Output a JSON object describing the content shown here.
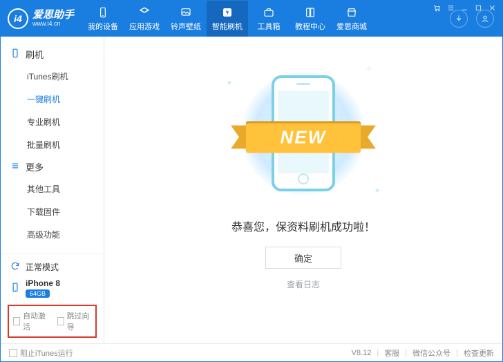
{
  "app": {
    "logo_text": "i4",
    "title": "爱思助手",
    "url": "www.i4.cn"
  },
  "nav": {
    "items": [
      {
        "name": "my-device",
        "label": "我的设备"
      },
      {
        "name": "apps-games",
        "label": "应用游戏"
      },
      {
        "name": "ring-wallpaper",
        "label": "铃声壁纸"
      },
      {
        "name": "smart-flash",
        "label": "智能刷机",
        "active": true
      },
      {
        "name": "toolbox",
        "label": "工具箱"
      },
      {
        "name": "tutorial",
        "label": "教程中心"
      },
      {
        "name": "mall",
        "label": "爱思商城"
      }
    ]
  },
  "sidebar": {
    "group_flash": "刷机",
    "flash_items": [
      {
        "label": "iTunes刷机"
      },
      {
        "label": "一键刷机",
        "active": true
      },
      {
        "label": "专业刷机"
      },
      {
        "label": "批量刷机"
      }
    ],
    "group_more": "更多",
    "more_items": [
      {
        "label": "其他工具"
      },
      {
        "label": "下载固件"
      },
      {
        "label": "高级功能"
      }
    ],
    "mode": "正常模式",
    "device_name": "iPhone 8",
    "storage_badge": "64GB",
    "auto_activate": "自动激活",
    "skip_guide": "跳过向导"
  },
  "main": {
    "ribbon": "NEW",
    "success_text": "恭喜您，保资料刷机成功啦！",
    "ok_button": "确定",
    "view_log": "查看日志"
  },
  "footer": {
    "block_itunes": "阻止iTunes运行",
    "version": "V8.12",
    "support": "客服",
    "wechat": "微信公众号",
    "check_update": "检查更新"
  }
}
